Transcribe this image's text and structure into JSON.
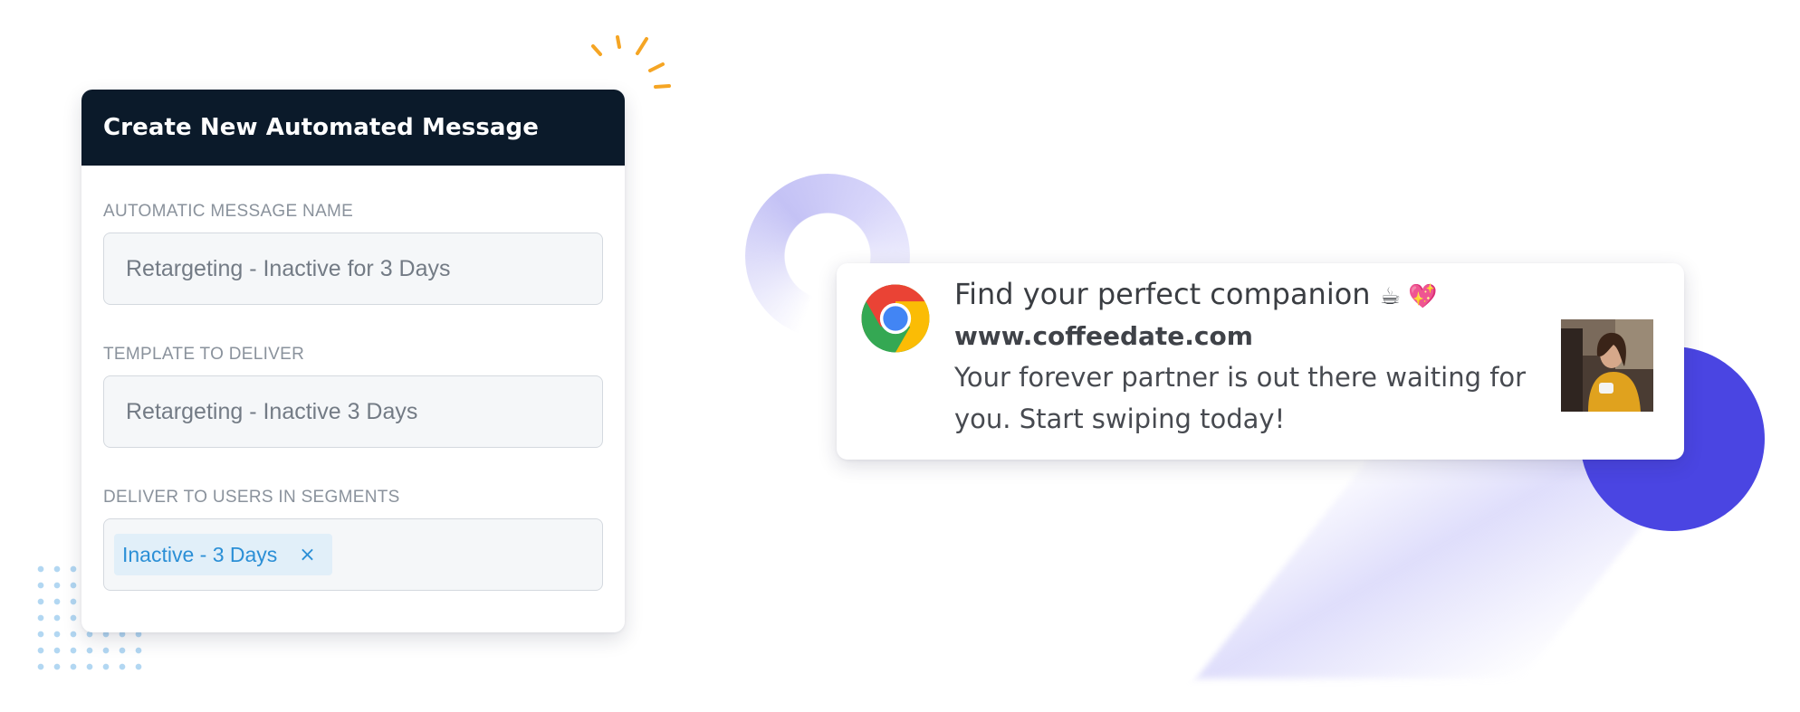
{
  "form": {
    "title": "Create New Automated Message",
    "fields": [
      {
        "label": "AUTOMATIC MESSAGE NAME",
        "value": "Retargeting - Inactive for 3 Days"
      },
      {
        "label": "TEMPLATE TO DELIVER",
        "value": "Retargeting - Inactive 3 Days"
      },
      {
        "label": "DELIVER TO USERS IN SEGMENTS",
        "chips": [
          {
            "label": "Inactive - 3 Days",
            "close": "×"
          }
        ]
      }
    ]
  },
  "notification": {
    "title": "Find your perfect companion",
    "emojis": "☕ 💖",
    "domain": "www.coffeedate.com",
    "body": "Your forever partner is out there waiting for you. Start swiping today!",
    "icon": "chrome-icon",
    "image": "woman-with-coffee-photo"
  },
  "colors": {
    "header_bg": "#0b1a2a",
    "chip_bg": "#e1eff9",
    "chip_text": "#2b8fd6",
    "accent_circle": "#4a45e2",
    "spark": "#f5a524"
  }
}
